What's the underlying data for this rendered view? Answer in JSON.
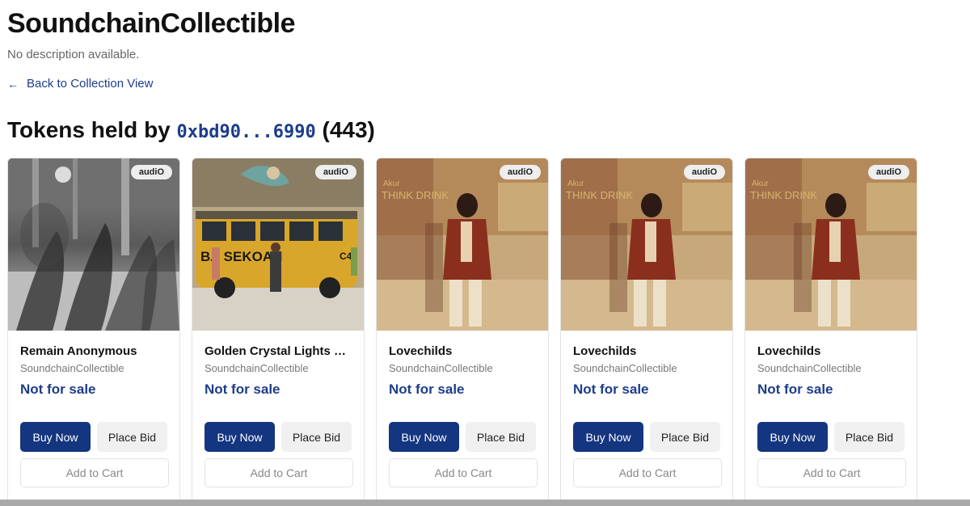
{
  "page": {
    "title": "SoundchainCollectible",
    "description": "No description available.",
    "back_link": "Back to Collection View",
    "tokens_prefix": "Tokens held by",
    "owner_address": "0xbd90...6990",
    "token_count": "(443)"
  },
  "cards": [
    {
      "badge": "audiO",
      "title": "Remain Anonymous",
      "collection": "SoundchainCollectible",
      "status": "Not for sale",
      "buy_label": "Buy Now",
      "bid_label": "Place Bid",
      "cart_label": "Add to Cart",
      "art": "station"
    },
    {
      "badge": "audiO",
      "title": "Golden Crystal Lights B...",
      "collection": "SoundchainCollectible",
      "status": "Not for sale",
      "buy_label": "Buy Now",
      "bid_label": "Place Bid",
      "cart_label": "Add to Cart",
      "art": "bus"
    },
    {
      "badge": "audiO",
      "title": "Lovechilds",
      "collection": "SoundchainCollectible",
      "status": "Not for sale",
      "buy_label": "Buy Now",
      "bid_label": "Place Bid",
      "cart_label": "Add to Cart",
      "art": "man"
    },
    {
      "badge": "audiO",
      "title": "Lovechilds",
      "collection": "SoundchainCollectible",
      "status": "Not for sale",
      "buy_label": "Buy Now",
      "bid_label": "Place Bid",
      "cart_label": "Add to Cart",
      "art": "man"
    },
    {
      "badge": "audiO",
      "title": "Lovechilds",
      "collection": "SoundchainCollectible",
      "status": "Not for sale",
      "buy_label": "Buy Now",
      "bid_label": "Place Bid",
      "cart_label": "Add to Cart",
      "art": "man"
    }
  ],
  "art_text": {
    "bus_sign": "BA SEKOAH",
    "bus_code": "C4",
    "album_line1": "Akur",
    "album_line2": "THINK DRINK"
  }
}
